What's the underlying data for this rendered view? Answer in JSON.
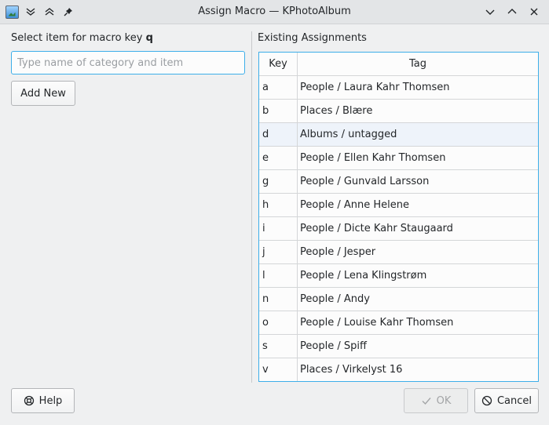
{
  "window": {
    "title": "Assign Macro — KPhotoAlbum",
    "icons": {
      "app": "kphotoalbum-app-icon",
      "keep_below": "keep-below-icon",
      "keep_above": "keep-above-icon",
      "pin": "pin-icon",
      "minimize": "minimize-icon",
      "maximize": "maximize-icon",
      "close": "close-icon"
    }
  },
  "left": {
    "label_prefix": "Select item for macro key ",
    "macro_key": "q",
    "search": {
      "value": "",
      "placeholder": "Type name of category and item"
    },
    "add_new_label": "Add New"
  },
  "right": {
    "label": "Existing Assignments",
    "columns": {
      "key": "Key",
      "tag": "Tag"
    },
    "rows": [
      {
        "key": "a",
        "tag": "People / Laura Kahr Thomsen"
      },
      {
        "key": "b",
        "tag": "Places / Blære"
      },
      {
        "key": "d",
        "tag": "Albums / untagged"
      },
      {
        "key": "e",
        "tag": "People / Ellen Kahr Thomsen"
      },
      {
        "key": "g",
        "tag": "People / Gunvald Larsson"
      },
      {
        "key": "h",
        "tag": "People / Anne Helene"
      },
      {
        "key": "i",
        "tag": "People / Dicte Kahr Staugaard"
      },
      {
        "key": "j",
        "tag": "People / Jesper"
      },
      {
        "key": "l",
        "tag": "People / Lena Klingstrøm"
      },
      {
        "key": "n",
        "tag": "People / Andy"
      },
      {
        "key": "o",
        "tag": "People / Louise Kahr Thomsen"
      },
      {
        "key": "s",
        "tag": "People / Spiff"
      },
      {
        "key": "v",
        "tag": "Places / Virkelyst 16"
      }
    ]
  },
  "buttons": {
    "help": "Help",
    "ok": "OK",
    "cancel": "Cancel"
  },
  "colors": {
    "accent": "#3daee9",
    "hover_row": "#eef3fa"
  }
}
